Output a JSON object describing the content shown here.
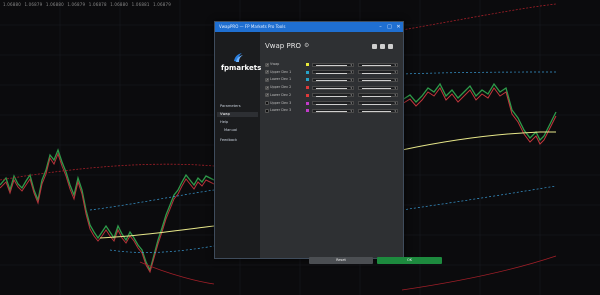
{
  "topbar": {
    "items": [
      "1.06880",
      "1.06879",
      "1.06880",
      "1.06879",
      "1.06878",
      "1.06880",
      "1.06881",
      "1.06879"
    ]
  },
  "window": {
    "title": "VwapPRO — FP Markets Pro Tools",
    "minimize_icon": "minimize-icon",
    "maximize_icon": "maximize-icon",
    "close_icon": "close-icon"
  },
  "brand": {
    "logo_text": "fpmarkets"
  },
  "sidebar": {
    "items": [
      {
        "label": "Parameters",
        "selected": false
      },
      {
        "label": "Vwap",
        "selected": true
      },
      {
        "label": "Help",
        "selected": false
      },
      {
        "label": "Manual",
        "selected": false
      },
      {
        "label": "Feedback",
        "selected": false
      }
    ]
  },
  "panel": {
    "title": "Vwap PRO",
    "rows": [
      {
        "label": "Vwap",
        "checked": true,
        "color": "#e8e83a"
      },
      {
        "label": "Upper Dev 1",
        "checked": true,
        "color": "#27a3c9"
      },
      {
        "label": "Lower Dev 1",
        "checked": true,
        "color": "#27a3c9"
      },
      {
        "label": "Upper Dev 2",
        "checked": true,
        "color": "#e03a3a"
      },
      {
        "label": "Lower Dev 2",
        "checked": true,
        "color": "#e03a3a"
      },
      {
        "label": "Upper Dev 3",
        "checked": false,
        "color": "#c23ac9"
      },
      {
        "label": "Lower Dev 3",
        "checked": false,
        "color": "#c23ac9"
      }
    ]
  },
  "buttons": {
    "reset": "Reset",
    "ok": "OK"
  },
  "colors": {
    "accent": "#1f6fd1",
    "ok_green": "#1d8a3e",
    "vwap_line": "#e8e88a",
    "band_blue": "#3a9cd6",
    "band_red": "#b5202a"
  }
}
